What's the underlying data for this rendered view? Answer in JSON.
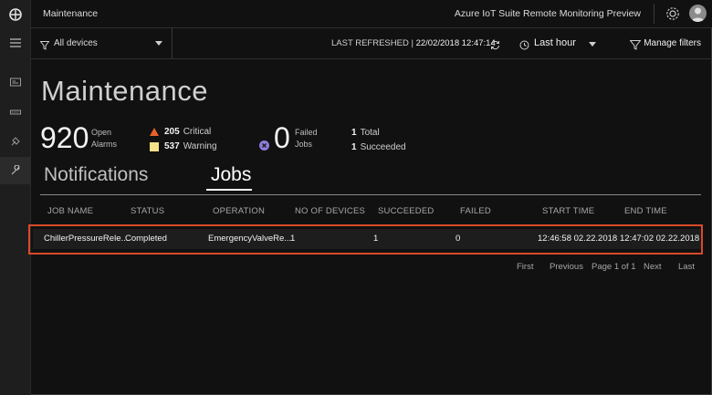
{
  "app": {
    "page_name": "Maintenance",
    "product_name": "Azure IoT Suite Remote Monitoring Preview"
  },
  "filters": {
    "device_group": "All devices",
    "last_refreshed_label": "LAST REFRESHED |",
    "last_refreshed_value": "22/02/2018 12:47:14",
    "time_range": "Last hour",
    "manage_filters": "Manage filters"
  },
  "summary": {
    "title": "Maintenance",
    "open_alarms_count": "920",
    "open_alarms_label_1": "Open",
    "open_alarms_label_2": "Alarms",
    "critical_count": "205",
    "critical_label": "Critical",
    "warning_count": "537",
    "warning_label": "Warning",
    "failed_jobs_count": "0",
    "failed_jobs_label_1": "Failed",
    "failed_jobs_label_2": "Jobs",
    "total_count": "1",
    "total_label": "Total",
    "succeeded_count": "1",
    "succeeded_label": "Succeeded"
  },
  "tabs": [
    {
      "label": "Notifications",
      "active": false
    },
    {
      "label": "Jobs",
      "active": true
    }
  ],
  "table": {
    "columns": [
      "JOB NAME",
      "STATUS",
      "OPERATION",
      "NO OF DEVICES",
      "SUCCEEDED",
      "FAILED",
      "START TIME",
      "END TIME"
    ],
    "rows": [
      {
        "job_name": "ChillerPressureRele...",
        "status": "Completed",
        "operation": "EmergencyValveRe...",
        "devices": "1",
        "succeeded": "1",
        "failed": "0",
        "start_time": "12:46:58 02.22.2018",
        "end_time": "12:47:02 02.22.2018"
      }
    ]
  },
  "pagination": {
    "first": "First",
    "previous": "Previous",
    "page": "Page 1 of 1",
    "next": "Next",
    "last": "Last"
  },
  "icons": {
    "critical": "triangle-critical-icon",
    "warning": "square-warning-icon",
    "failed": "x-circle-icon"
  },
  "colors": {
    "critical": "#e8622c",
    "warning": "#f5e08a",
    "failed": "#8f7bdb",
    "highlight": "#d84a2a"
  }
}
